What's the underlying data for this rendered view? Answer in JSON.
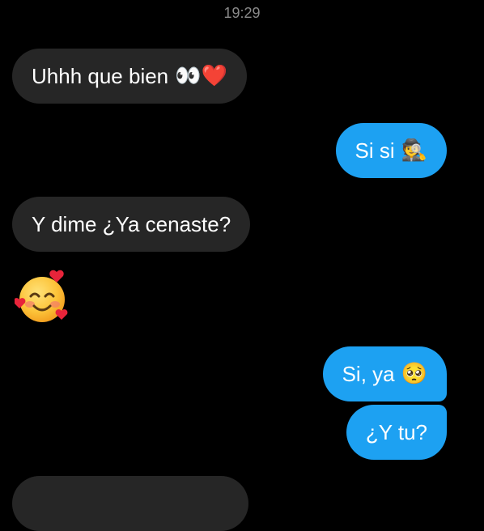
{
  "status": {
    "time": "19:29"
  },
  "messages": [
    {
      "direction": "incoming",
      "text": "Uhhh que bien",
      "emoji": "👀❤️"
    },
    {
      "direction": "outgoing",
      "text": "Si si",
      "emoji": "🕵️"
    },
    {
      "direction": "incoming",
      "text": "Y dime ¿Ya cenaste?",
      "emoji": ""
    },
    {
      "direction": "incoming",
      "text": "",
      "emoji": "🥰"
    },
    {
      "direction": "outgoing",
      "text": "Si, ya",
      "emoji": "🥺"
    },
    {
      "direction": "outgoing",
      "text": "¿Y tu?",
      "emoji": ""
    }
  ],
  "colors": {
    "background": "#000000",
    "incoming_bubble": "#262626",
    "outgoing_bubble": "#1da1f2",
    "text": "#ffffff",
    "timestamp": "#8a8a8a"
  }
}
